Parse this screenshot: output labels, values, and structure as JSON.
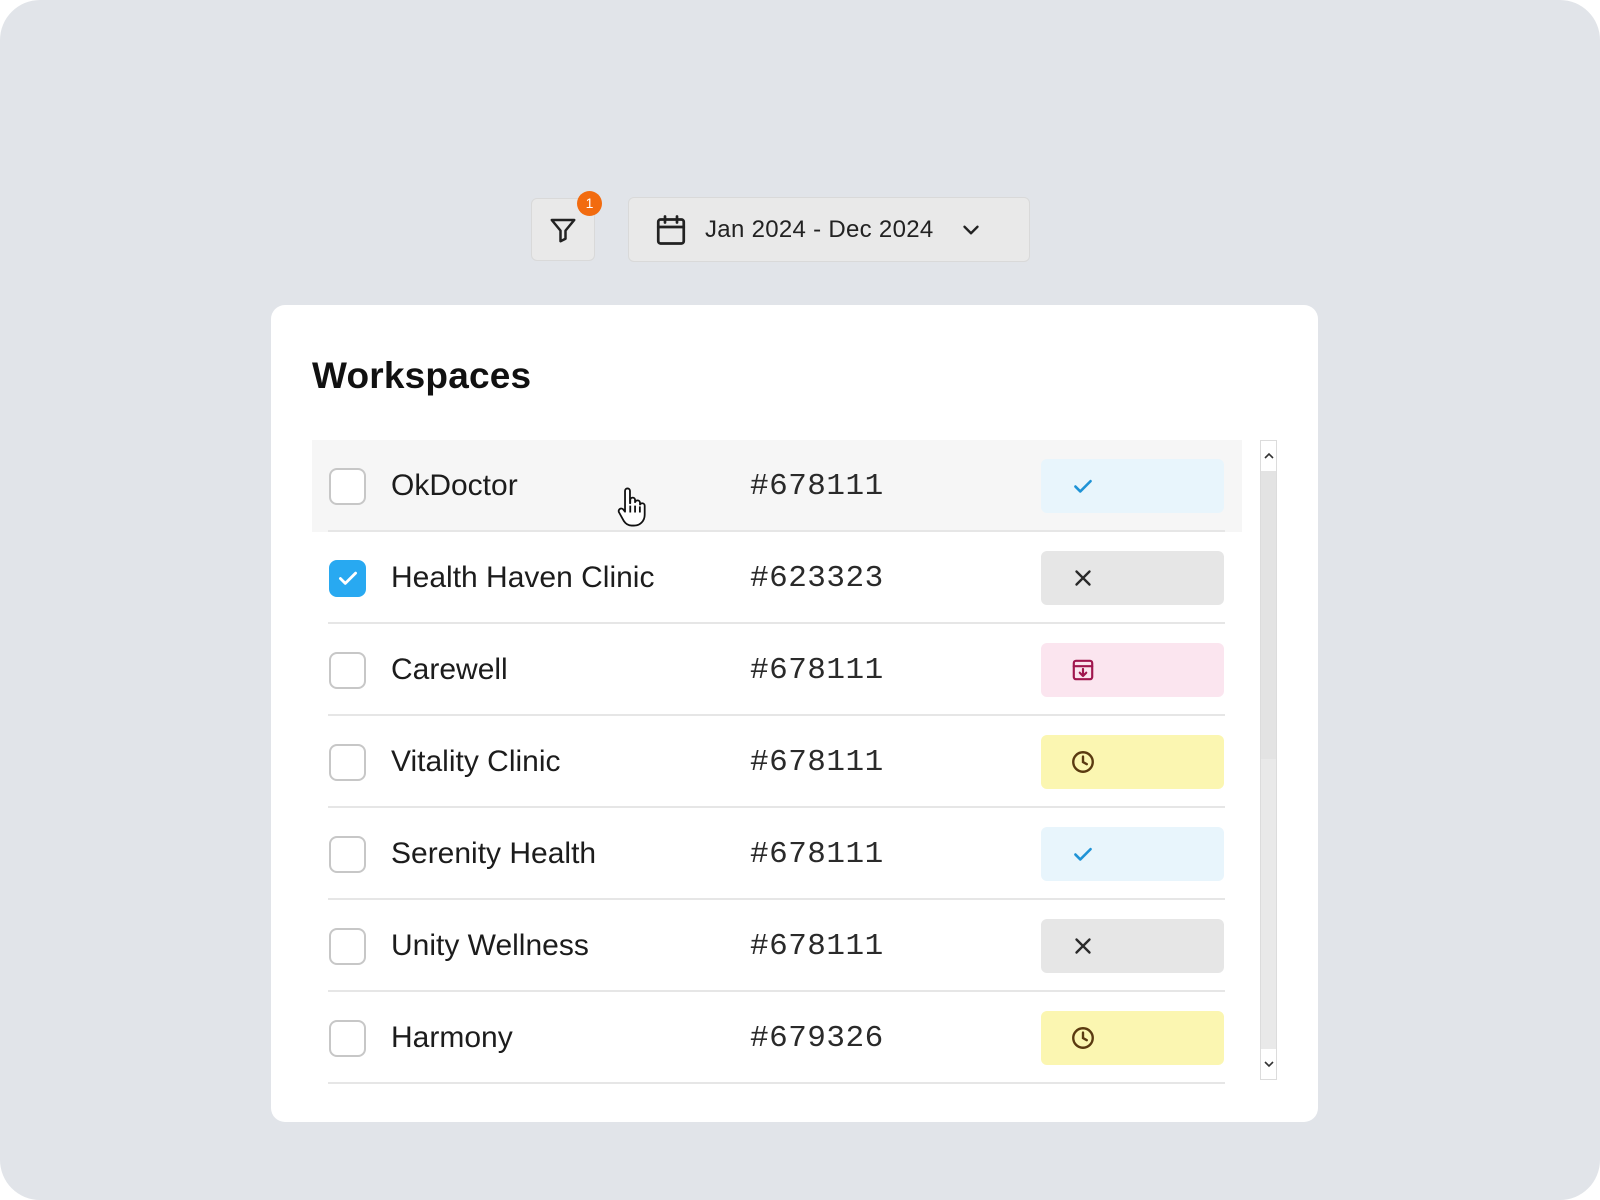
{
  "toolbar": {
    "filter_badge": "1",
    "date_range": "Jan 2024 - Dec 2024"
  },
  "card": {
    "title": "Workspaces"
  },
  "colors": {
    "background": "#e1e4e9",
    "checkbox_checked": "#28a9f1",
    "badge": "#f26b0f",
    "status_approved_bg": "#e8f5fc",
    "status_approved_fg": "#1f93d6",
    "status_rejected_bg": "#e6e6e6",
    "status_rejected_fg": "#2a2a2a",
    "status_archived_bg": "#fbe5ef",
    "status_archived_fg": "#a0164e",
    "status_pending_bg": "#fbf6b1",
    "status_pending_fg": "#5a3a10"
  },
  "workspaces": [
    {
      "name": "OkDoctor",
      "code": "#678111",
      "checked": false,
      "status": "approved",
      "status_icon": "check-icon"
    },
    {
      "name": "Health Haven Clinic",
      "code": "#623323",
      "checked": true,
      "status": "rejected",
      "status_icon": "x-icon"
    },
    {
      "name": "Carewell",
      "code": "#678111",
      "checked": false,
      "status": "archived",
      "status_icon": "archive-icon"
    },
    {
      "name": "Vitality Clinic",
      "code": "#678111",
      "checked": false,
      "status": "pending",
      "status_icon": "clock-icon"
    },
    {
      "name": "Serenity Health",
      "code": "#678111",
      "checked": false,
      "status": "approved",
      "status_icon": "check-icon"
    },
    {
      "name": "Unity Wellness",
      "code": "#678111",
      "checked": false,
      "status": "rejected",
      "status_icon": "x-icon"
    },
    {
      "name": "Harmony",
      "code": "#679326",
      "checked": false,
      "status": "pending",
      "status_icon": "clock-icon"
    }
  ]
}
